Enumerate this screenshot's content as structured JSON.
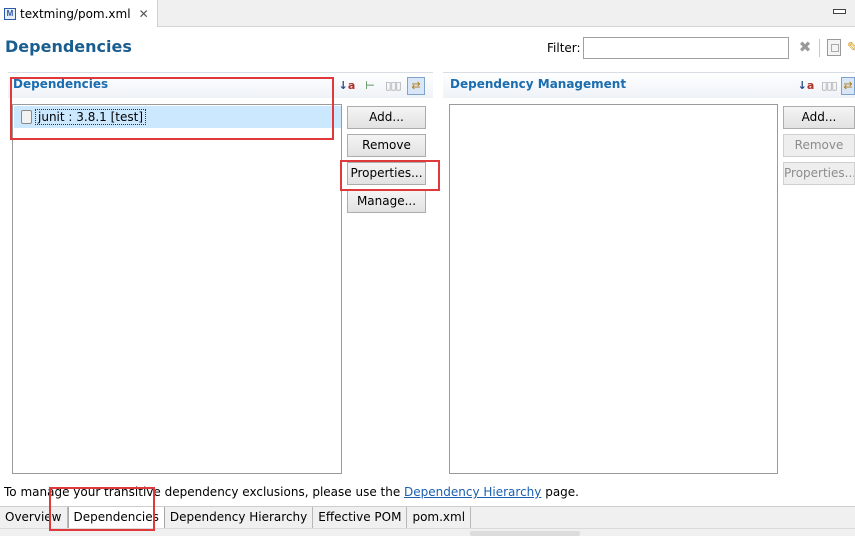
{
  "editor": {
    "tab_title": "textming/pom.xml",
    "file_icon_letter": "M"
  },
  "page": {
    "title": "Dependencies",
    "filter_label": "Filter:",
    "filter_value": ""
  },
  "dependencies": {
    "title": "Dependencies",
    "items": [
      {
        "label": "junit : 3.8.1 [test]"
      }
    ],
    "buttons": {
      "add": "Add...",
      "remove": "Remove",
      "properties": "Properties...",
      "manage": "Manage..."
    }
  },
  "dependency_management": {
    "title": "Dependency Management",
    "items": [],
    "buttons": {
      "add": "Add...",
      "remove": "Remove",
      "properties": "Properties..."
    },
    "disabled_buttons": [
      "remove",
      "properties"
    ]
  },
  "footer": {
    "text_before": "To manage your transitive dependency exclusions, please use the ",
    "link": "Dependency Hierarchy",
    "text_after": " page."
  },
  "page_tabs": [
    {
      "label": "Overview",
      "active": false
    },
    {
      "label": "Dependencies",
      "active": true
    },
    {
      "label": "Dependency Hierarchy",
      "active": false
    },
    {
      "label": "Effective POM",
      "active": false
    },
    {
      "label": "pom.xml",
      "active": false
    }
  ],
  "colors": {
    "section_title": "#1a6db0",
    "page_title": "#1a5d8f",
    "selection": "#cce8ff",
    "annotation": "#e0393c",
    "link": "#1a5fb0"
  }
}
